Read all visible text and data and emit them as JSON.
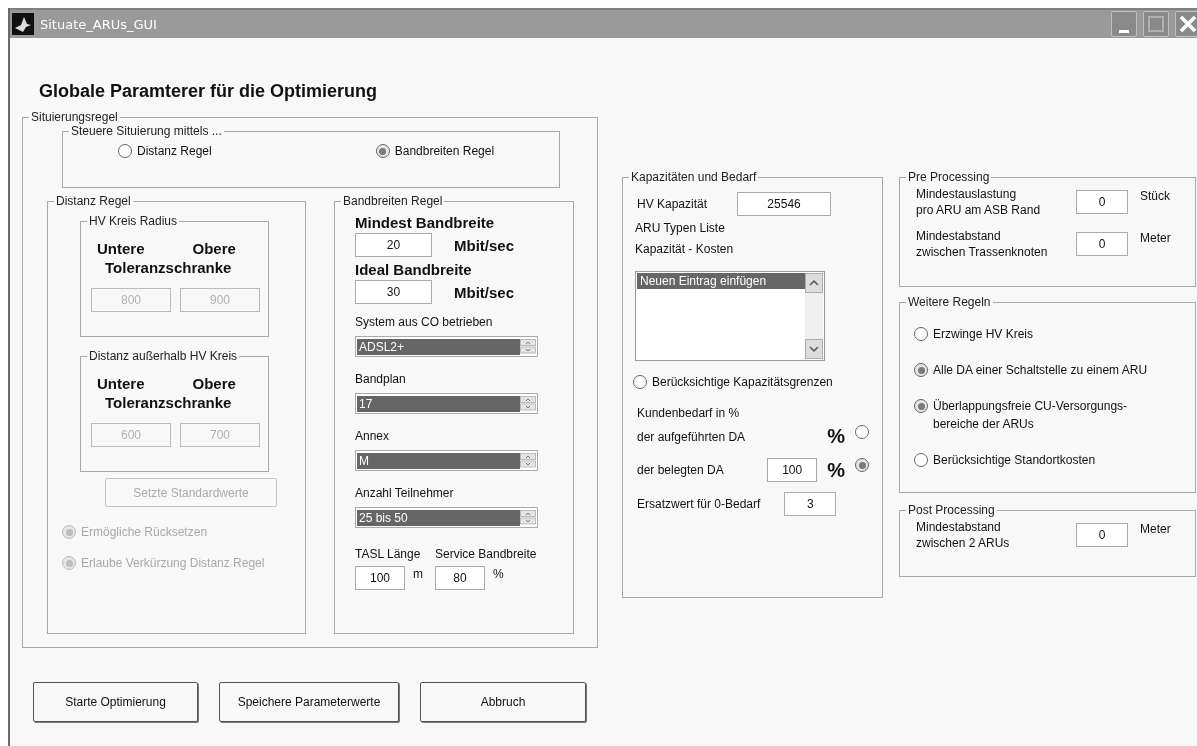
{
  "window": {
    "title": "Situate_ARUs_GUI"
  },
  "heading": "Globale Paramterer für die Optimierung",
  "situierungsregel": {
    "title": "Situierungsregel",
    "steuere": {
      "title": "Steuere Situierung mittels ...",
      "options": [
        {
          "label": "Distanz Regel",
          "selected": false
        },
        {
          "label": "Bandbreiten Regel",
          "selected": true
        }
      ]
    },
    "distanz_regel": {
      "title": "Distanz Regel",
      "groups": [
        {
          "title": "HV Kreis Radius",
          "header_1": "Untere",
          "header_2": "Obere",
          "header_3": "Toleranzschranke",
          "values": [
            "800",
            "900"
          ],
          "disabled": true
        },
        {
          "title": "Distanz außerhalb HV Kreis",
          "header_1": "Untere",
          "header_2": "Obere",
          "header_3": "Toleranzschranke",
          "values": [
            "600",
            "700"
          ],
          "disabled": true
        }
      ],
      "default_button": {
        "label": "Setzte Standardwerte",
        "disabled": true
      },
      "options": [
        {
          "label": "Ermögliche Rücksetzen",
          "selected": true,
          "disabled": true
        },
        {
          "label": "Erlaube Verkürzung Distanz Regel",
          "selected": true,
          "disabled": true
        }
      ]
    },
    "bandbreiten_regel": {
      "title": "Bandbreiten Regel",
      "rates": [
        {
          "label": "Mindest Bandbreite",
          "value": "20",
          "unit": "Mbit/sec"
        },
        {
          "label": "Ideal Bandbreite",
          "value": "30",
          "unit": "Mbit/sec"
        }
      ],
      "lists": [
        {
          "label": "System aus CO betrieben",
          "value": "ADSL2+"
        },
        {
          "label": "Bandplan",
          "value": "17"
        },
        {
          "label": "Annex",
          "value": "M"
        },
        {
          "label": "Anzahl Teilnehmer",
          "value": "25 bis 50"
        }
      ],
      "small_fields": [
        {
          "label": "TASL Länge",
          "value": "100",
          "unit": "m"
        },
        {
          "label": "Service Bandbreite",
          "value": "80",
          "unit": "%"
        }
      ]
    }
  },
  "kapazitaeten": {
    "title": "Kapazitäten und Bedarf",
    "hv_label": "HV Kapazität",
    "hv_value": "25546",
    "list_label_1": "ARU Typen Liste",
    "list_label_2": "Kapazität - Kosten",
    "list_items": [
      {
        "label": "Neuen Eintrag einfügen",
        "selected": true
      }
    ],
    "limit_option": {
      "label": "Berücksichtige Kapazitätsgrenzen",
      "selected": false
    },
    "demand_label": "Kundenbedarf in %",
    "demand_rows": [
      {
        "label": "der aufgeführten DA",
        "symbol": "%",
        "selected": false
      },
      {
        "label": "der belegten DA",
        "value": "100",
        "symbol": "%",
        "selected": true
      }
    ],
    "zero_label": "Ersatzwert für 0-Bedarf",
    "zero_value": "3"
  },
  "pre_processing": {
    "title": "Pre Processing",
    "rows": [
      {
        "lines": [
          "Mindestauslastung",
          "pro ARU am ASB Rand"
        ],
        "value": "0",
        "unit": "Stück"
      },
      {
        "lines": [
          "Mindestabstand",
          "zwischen Trassenknoten"
        ],
        "value": "0",
        "unit": "Meter"
      }
    ]
  },
  "weitere_regeln": {
    "title": "Weitere Regeln",
    "options": [
      {
        "lines": [
          "Erzwinge HV Kreis"
        ],
        "selected": false
      },
      {
        "lines": [
          "Alle DA einer Schaltstelle zu einem ARU"
        ],
        "selected": true
      },
      {
        "lines": [
          "Überlappungsfreie CU-Versorgungs-",
          "bereiche der ARUs"
        ],
        "selected": true
      },
      {
        "lines": [
          "Berücksichtige Standortkosten"
        ],
        "selected": false
      }
    ]
  },
  "post_processing": {
    "title": "Post Processing",
    "rows": [
      {
        "lines": [
          "Mindestabstand",
          "zwischen 2 ARUs"
        ],
        "value": "0",
        "unit": "Meter"
      }
    ]
  },
  "buttons": [
    "Starte Optimierung",
    "Speichere Parameterwerte",
    "Abbruch"
  ]
}
